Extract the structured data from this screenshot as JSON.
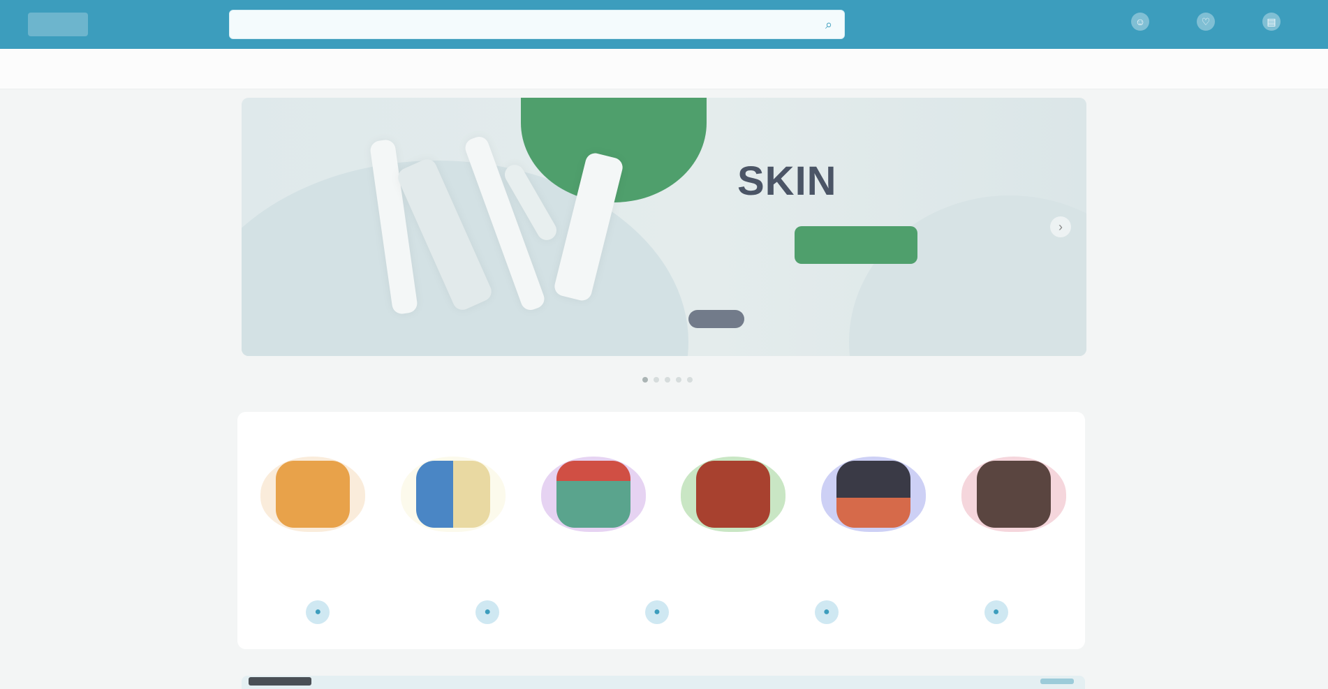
{
  "header": {
    "logo_text": "",
    "search": {
      "placeholder": "",
      "value": ""
    },
    "actions": [
      {
        "label": "",
        "icon": "user-icon"
      },
      {
        "label": "",
        "icon": "heart-icon"
      },
      {
        "label": "",
        "icon": "cart-icon"
      }
    ]
  },
  "category_nav": {
    "items": [
      "",
      "",
      "",
      "",
      "",
      "",
      "",
      "",
      "",
      "",
      "",
      ""
    ]
  },
  "hero": {
    "title": "SKIN",
    "title_suffix": "",
    "cta_label": "",
    "colors": {
      "accent": "#4f9f6c",
      "background": "#e2eaeb"
    }
  },
  "carousel": {
    "slide_count": 5,
    "active_index": 0
  },
  "featured": {
    "title": "",
    "view_all_label": "",
    "categories": [
      {
        "label": "",
        "color": "#e8a24a",
        "inner": "#c5683c"
      },
      {
        "label": "",
        "color": "#f2e4a0",
        "inner": "#4a86c5"
      },
      {
        "label": "",
        "color": "#e6d3f2",
        "inner": "#d04f44"
      },
      {
        "label": "",
        "color": "#c9e6c4",
        "inner": "#a8412f"
      },
      {
        "label": "",
        "color": "#cdd0f5",
        "inner": "#3a3a46"
      },
      {
        "label": "",
        "color": "#f5d6dc",
        "inner": "#5a4540"
      }
    ],
    "pills": [
      {
        "label": "",
        "icon": "drop-icon"
      },
      {
        "label": "",
        "icon": "drop-icon"
      },
      {
        "label": "",
        "icon": "drop-icon"
      },
      {
        "label": "",
        "icon": "drop-icon"
      },
      {
        "label": "",
        "icon": "drop-icon"
      }
    ]
  },
  "theme": {
    "primary": "#3c9dbd",
    "page_bg": "#f3f5f5"
  }
}
